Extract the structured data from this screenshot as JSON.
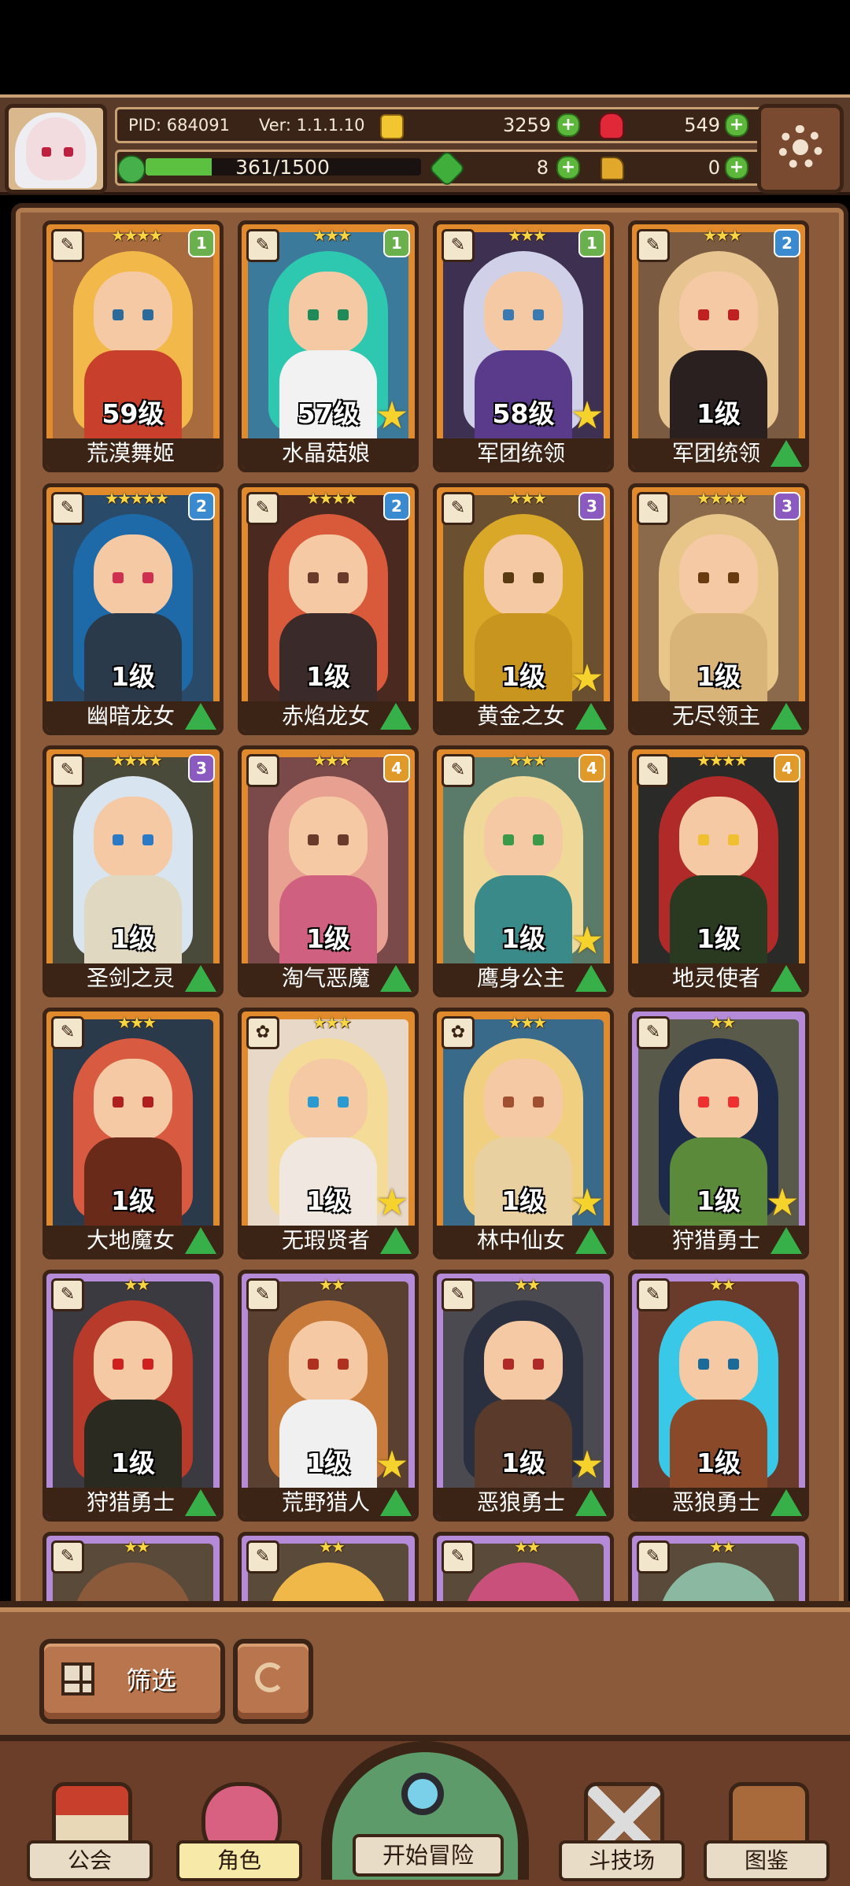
{
  "header": {
    "pid": "PID: 684091",
    "version": "Ver: 1.1.1.10",
    "exp": "361/1500",
    "exp_ratio": 0.24,
    "gold": "3259",
    "gems": "549",
    "clover": "8",
    "key": "0"
  },
  "cards": [
    {
      "name": "荒漠舞姬",
      "level": "59级",
      "stars": "★★★★",
      "badge": "1",
      "badge_color": "#6ab04c",
      "frame": "orange",
      "hair": "#f2b94a",
      "body": "#c8402c",
      "eye": "#2c6a9a",
      "bg": "#a86b3e",
      "star": false,
      "up": false
    },
    {
      "name": "水晶菇娘",
      "level": "57级",
      "stars": "★★★",
      "badge": "1",
      "badge_color": "#6ab04c",
      "frame": "orange",
      "hair": "#2ec7b0",
      "body": "#f2f2f2",
      "eye": "#1e8a5a",
      "bg": "#3b7a9a",
      "star": true,
      "up": false
    },
    {
      "name": "军团统领",
      "level": "58级",
      "stars": "★★★",
      "badge": "1",
      "badge_color": "#6ab04c",
      "frame": "orange",
      "hair": "#d0d0e8",
      "body": "#5a3a8a",
      "eye": "#3a7ab0",
      "bg": "#3d3050",
      "star": true,
      "up": false
    },
    {
      "name": "军团统领",
      "level": "1级",
      "stars": "★★★",
      "badge": "2",
      "badge_color": "#3a8ad0",
      "frame": "orange",
      "hair": "#e8c590",
      "body": "#2a2020",
      "eye": "#c02020",
      "bg": "#7a5a40",
      "star": false,
      "up": true
    },
    {
      "name": "幽暗龙女",
      "level": "1级",
      "stars": "★★★★★",
      "badge": "2",
      "badge_color": "#3a8ad0",
      "frame": "orange",
      "hair": "#1e6aa8",
      "body": "#2a3a4a",
      "eye": "#d03050",
      "bg": "#2a4a6a",
      "star": false,
      "up": true
    },
    {
      "name": "赤焰龙女",
      "level": "1级",
      "stars": "★★★★",
      "badge": "2",
      "badge_color": "#3a8ad0",
      "frame": "orange",
      "hair": "#d85a3a",
      "body": "#3a2a2a",
      "eye": "#6a3a2a",
      "bg": "#4a2a20",
      "star": false,
      "up": true
    },
    {
      "name": "黄金之女",
      "level": "1级",
      "stars": "★★★",
      "badge": "3",
      "badge_color": "#8a5ac0",
      "frame": "orange",
      "hair": "#d9a828",
      "body": "#c8961e",
      "eye": "#5a3a10",
      "bg": "#6a5030",
      "star": true,
      "up": true
    },
    {
      "name": "无尽领主",
      "level": "1级",
      "stars": "★★★★",
      "badge": "3",
      "badge_color": "#8a5ac0",
      "frame": "orange",
      "hair": "#e8c68a",
      "body": "#d8b478",
      "eye": "#6a3a10",
      "bg": "#8a6a4a",
      "star": false,
      "up": true
    },
    {
      "name": "圣剑之灵",
      "level": "1级",
      "stars": "★★★★",
      "badge": "3",
      "badge_color": "#8a5ac0",
      "frame": "orange",
      "hair": "#d8e4f0",
      "body": "#e0d8c0",
      "eye": "#2a7ac8",
      "bg": "#4a4a3a",
      "star": false,
      "up": true
    },
    {
      "name": "淘气恶魔",
      "level": "1级",
      "stars": "★★★",
      "badge": "4",
      "badge_color": "#e09a2a",
      "frame": "orange",
      "hair": "#e8a090",
      "body": "#d06080",
      "eye": "#6a3a2a",
      "bg": "#7a4a4a",
      "star": false,
      "up": true
    },
    {
      "name": "鹰身公主",
      "level": "1级",
      "stars": "★★★",
      "badge": "4",
      "badge_color": "#e09a2a",
      "frame": "orange",
      "hair": "#f0d898",
      "body": "#3a8a8a",
      "eye": "#3a9a4a",
      "bg": "#5a7a6a",
      "star": true,
      "up": true
    },
    {
      "name": "地灵使者",
      "level": "1级",
      "stars": "★★★★",
      "badge": "4",
      "badge_color": "#e09a2a",
      "frame": "orange",
      "hair": "#b02a2a",
      "body": "#2a3a20",
      "eye": "#f0c030",
      "bg": "#2a2a28",
      "star": false,
      "up": true
    },
    {
      "name": "大地魔女",
      "level": "1级",
      "stars": "★★★",
      "badge": "",
      "badge_color": "",
      "frame": "orange",
      "hair": "#d85a40",
      "body": "#6a2a1a",
      "eye": "#b02020",
      "bg": "#2a3a4a",
      "star": false,
      "up": true
    },
    {
      "name": "无瑕贤者",
      "level": "1级",
      "stars": "★★★",
      "badge": "",
      "badge_color": "",
      "frame": "orange",
      "hair": "#f4dc98",
      "body": "#f0e8e0",
      "eye": "#2a9ad0",
      "bg": "#e8d8c8",
      "star": true,
      "up": true
    },
    {
      "name": "林中仙女",
      "level": "1级",
      "stars": "★★★",
      "badge": "",
      "badge_color": "",
      "frame": "orange",
      "hair": "#f0d080",
      "body": "#e8d0a0",
      "eye": "#a05030",
      "bg": "#3a6a8a",
      "star": true,
      "up": true
    },
    {
      "name": "狩猎勇士",
      "level": "1级",
      "stars": "★★",
      "badge": "",
      "badge_color": "",
      "frame": "purple",
      "hair": "#1e2a4a",
      "body": "#5a8a3a",
      "eye": "#f03030",
      "bg": "#5a5a4a",
      "star": true,
      "up": true
    },
    {
      "name": "狩猎勇士",
      "level": "1级",
      "stars": "★★",
      "badge": "",
      "badge_color": "",
      "frame": "purple",
      "hair": "#b83a2a",
      "body": "#2a2a20",
      "eye": "#d02020",
      "bg": "#3a3a40",
      "star": false,
      "up": true
    },
    {
      "name": "荒野猎人",
      "level": "1级",
      "stars": "★★",
      "badge": "",
      "badge_color": "",
      "frame": "purple",
      "hair": "#c87a3a",
      "body": "#f0f0f0",
      "eye": "#b03020",
      "bg": "#5a4030",
      "star": true,
      "up": true
    },
    {
      "name": "恶狼勇士",
      "level": "1级",
      "stars": "★★",
      "badge": "",
      "badge_color": "",
      "frame": "purple",
      "hair": "#2a3040",
      "body": "#5a3a2a",
      "eye": "#b02a2a",
      "bg": "#4a4a50",
      "star": true,
      "up": true
    },
    {
      "name": "恶狼勇士",
      "level": "1级",
      "stars": "★★",
      "badge": "",
      "badge_color": "",
      "frame": "purple",
      "hair": "#3ac8e8",
      "body": "#8a4a2a",
      "eye": "#1a6a9a",
      "bg": "#6a3a2a",
      "star": false,
      "up": true
    }
  ],
  "partial_cards": [
    {
      "stars": "★★",
      "frame": "purple",
      "hair": "#8a5a3a"
    },
    {
      "stars": "★★",
      "frame": "purple",
      "hair": "#f0b848"
    },
    {
      "stars": "★★",
      "frame": "purple",
      "hair": "#c8507a"
    },
    {
      "stars": "★★",
      "frame": "purple",
      "hair": "#8ab8a0"
    }
  ],
  "controls": {
    "filter_label": "筛选"
  },
  "nav": {
    "guild": "公会",
    "character": "角色",
    "adventure": "开始冒险",
    "arena": "斗技场",
    "codex": "图鉴"
  }
}
